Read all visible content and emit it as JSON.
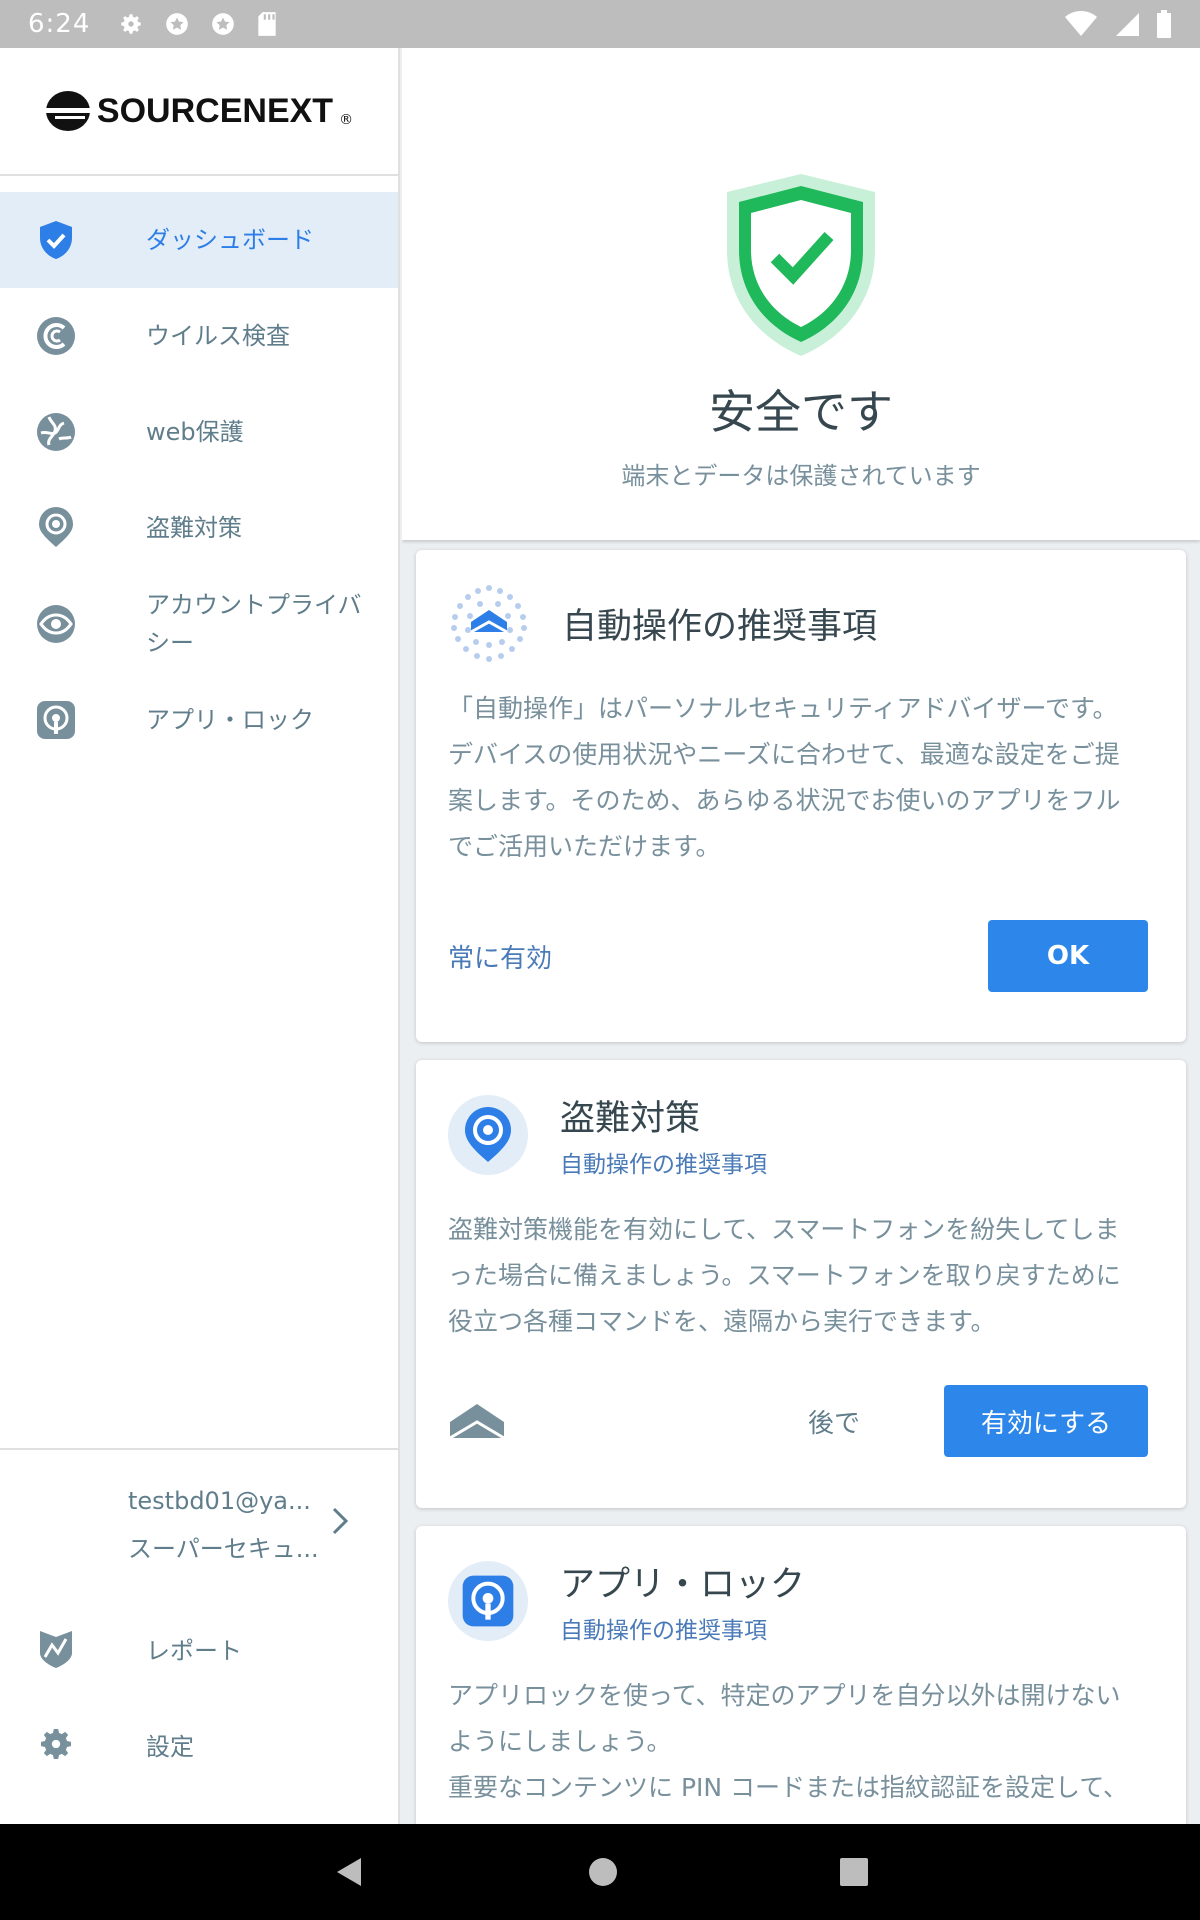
{
  "status_bar": {
    "time": "6:24",
    "icons": [
      "settings-icon",
      "badge-icon",
      "badge-icon",
      "sd-card-icon"
    ],
    "right_icons": [
      "wifi-icon",
      "signal-icon",
      "battery-icon"
    ]
  },
  "drawer": {
    "logo": "SOURCENEXT",
    "logo_mark": "®",
    "items": [
      {
        "label": "ダッシュボード",
        "icon": "shield-check-icon",
        "active": true
      },
      {
        "label": "ウイルス検査",
        "icon": "scan-icon"
      },
      {
        "label": "web保護",
        "icon": "web-globe-icon"
      },
      {
        "label": "盗難対策",
        "icon": "location-pin-icon"
      },
      {
        "label": "アカウントプライバシー",
        "icon": "eye-icon"
      },
      {
        "label": "アプリ・ロック",
        "icon": "app-lock-icon"
      }
    ],
    "account": {
      "email": "testbd01@ya...",
      "plan": "スーパーセキュ..."
    },
    "bottom_items": [
      {
        "label": "レポート",
        "icon": "report-icon"
      },
      {
        "label": "設定",
        "icon": "gear-icon"
      }
    ]
  },
  "hero": {
    "title": "安全です",
    "subtitle": "端末とデータは保護されています"
  },
  "cards": [
    {
      "title": "自動操作の推奨事項",
      "body_lines": [
        "「自動操作」はパーソナルセキュリティアドバイザーです。",
        "デバイスの使用状況やニーズに合わせて、最適な設定をご提",
        "案します。そのため、あらゆる状況でお使いのアプリをフル",
        "でご活用いただけます。"
      ],
      "secondary_action": "常に有効",
      "primary_action": "OK"
    },
    {
      "title": "盗難対策",
      "subtitle": "自動操作の推奨事項",
      "body_lines": [
        "盗難対策機能を有効にして、スマートフォンを紛失してしま",
        "った場合に備えましょう。スマートフォンを取り戻すために",
        "役立つ各種コマンドを、遠隔から実行できます。"
      ],
      "secondary_action": "後で",
      "primary_action": "有効にする"
    },
    {
      "title": "アプリ・ロック",
      "subtitle": "自動操作の推奨事項",
      "body_lines": [
        "アプリロックを使って、特定のアプリを自分以外は開けない",
        "ようにしましょう。",
        "重要なコンテンツに PIN コードまたは指紋認証を設定して、"
      ]
    }
  ],
  "colors": {
    "accent": "#2d87ea",
    "safe_green": "#1fb85a",
    "drawer_active_bg": "#e3edf8"
  }
}
